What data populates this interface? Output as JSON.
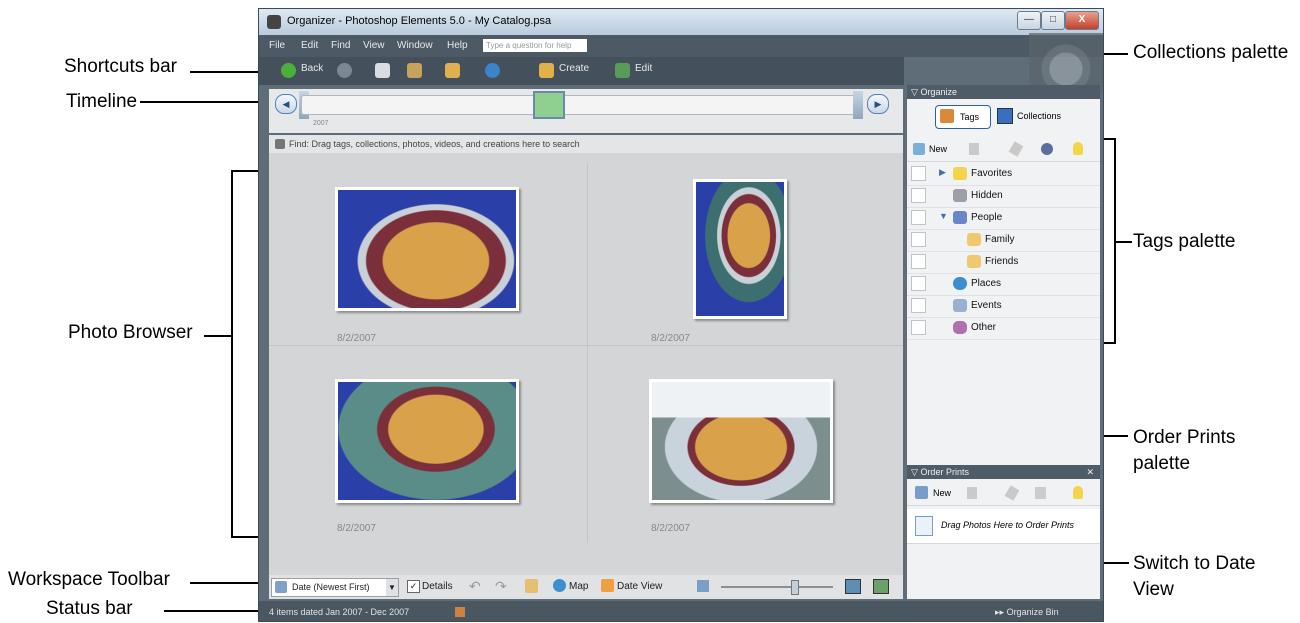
{
  "callouts": {
    "shortcuts_bar": "Shortcuts bar",
    "timeline": "Timeline",
    "photo_browser": "Photo Browser",
    "workspace_toolbar": "Workspace Toolbar",
    "status_bar": "Status bar",
    "collections_palette": "Collections palette",
    "tags_palette": "Tags palette",
    "order_prints_palette_1": "Order Prints",
    "order_prints_palette_2": "palette",
    "switch_date_view_1": "Switch to Date",
    "switch_date_view_2": "View"
  },
  "window": {
    "title": "Organizer - Photoshop Elements 5.0 - My Catalog.psa",
    "buttons": {
      "minimize": "—",
      "maximize": "□",
      "close": "X"
    }
  },
  "menu": {
    "items": [
      "File",
      "Edit",
      "Find",
      "View",
      "Window",
      "Help"
    ],
    "help_placeholder": "Type a question for help"
  },
  "shortcuts": {
    "back": "Back",
    "create": "Create",
    "edit": "Edit"
  },
  "timeline": {
    "year": "2007"
  },
  "find_bar": {
    "text": "Find: Drag tags, collections, photos, videos, and creations here to search"
  },
  "photos": [
    {
      "date": "8/2/2007"
    },
    {
      "date": "8/2/2007"
    },
    {
      "date": "8/2/2007"
    },
    {
      "date": "8/2/2007"
    }
  ],
  "workspace": {
    "sort": "Date (Newest First)",
    "details_label": "Details",
    "details_checked": true,
    "map_label": "Map",
    "date_view_label": "Date View"
  },
  "status": {
    "text": "4 items dated Jan 2007 - Dec 2007",
    "organize_bin": "Organize Bin"
  },
  "organize": {
    "header": "Organize",
    "tabs": [
      "Tags",
      "Collections"
    ],
    "new_label": "New",
    "tags": [
      {
        "label": "Favorites"
      },
      {
        "label": "Hidden"
      },
      {
        "label": "People"
      },
      {
        "label": "Family"
      },
      {
        "label": "Friends"
      },
      {
        "label": "Places"
      },
      {
        "label": "Events"
      },
      {
        "label": "Other"
      }
    ]
  },
  "order_prints": {
    "header": "Order Prints",
    "close": "✕",
    "new_label": "New",
    "drop_text": "Drag Photos Here to Order Prints"
  },
  "colors": {
    "chrome_dark": "#44505b",
    "browser_bg": "#d4d5d6",
    "panel_bg": "#f1f2f3",
    "accent_blue": "#2b5fa8",
    "pie_blue": "#2745a8"
  }
}
